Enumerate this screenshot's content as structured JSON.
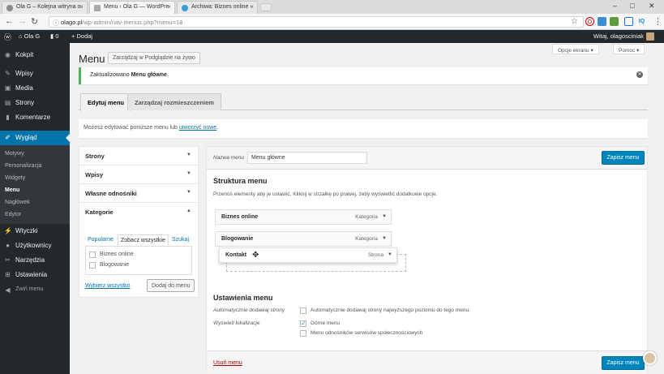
{
  "browser": {
    "tabs": [
      {
        "title": "Ola G – Kolejna witryna o"
      },
      {
        "title": "Menu ‹ Ola G — WordPre"
      },
      {
        "title": "Archiwa: Biznes online -"
      }
    ],
    "url_host": "olago.pl",
    "url_path": "/wp-admin/nav-menus.php?menu=18"
  },
  "adminbar": {
    "site": "Ola G",
    "comments": "0",
    "add_new": "Dodaj",
    "greeting": "Witaj, olagosciniak"
  },
  "sidebar": {
    "items": [
      {
        "label": "Kokpit",
        "icon": "dashboard-icon"
      },
      {
        "label": "Wpisy",
        "icon": "pin-icon"
      },
      {
        "label": "Media",
        "icon": "media-icon"
      },
      {
        "label": "Strony",
        "icon": "page-icon"
      },
      {
        "label": "Komentarze",
        "icon": "comment-icon"
      },
      {
        "label": "Wygląd",
        "icon": "brush-icon"
      },
      {
        "label": "Wtyczki",
        "icon": "plugin-icon"
      },
      {
        "label": "Użytkownicy",
        "icon": "users-icon"
      },
      {
        "label": "Narzędzia",
        "icon": "wrench-icon"
      },
      {
        "label": "Ustawienia",
        "icon": "settings-icon"
      },
      {
        "label": "Zwiń menu",
        "icon": "collapse-icon"
      }
    ],
    "submenu": [
      "Motywy",
      "Personalizacja",
      "Widgety",
      "Menu",
      "Nagłówek",
      "Edytor"
    ]
  },
  "screen_options": "Opcje ekranu",
  "help": "Pomoc",
  "page": {
    "title": "Menu",
    "live_preview": "Zarządzaj w Podglądzie na żywo",
    "notice_prefix": "Zaktualizowano",
    "notice_menu": "Menu główne",
    "notice_suffix": ".",
    "tabs": [
      "Edytuj menu",
      "Zarządzaj rozmieszczeniem"
    ],
    "info_text": "Możesz edytować poniższe menu lub",
    "info_link": "utworzyć nowe",
    "info_end": "."
  },
  "left": {
    "sections": [
      "Strony",
      "Wpisy",
      "Własne odnośniki",
      "Kategorie"
    ],
    "cat_tabs": [
      "Popularne",
      "Zobacz wszystkie",
      "Szukaj"
    ],
    "categories": [
      "Biznes online",
      "Blogowanie"
    ],
    "select_all": "Wybierz wszystko",
    "add_to_menu": "Dodaj do menu"
  },
  "right": {
    "menu_name_label": "Nazwa menu",
    "menu_name_value": "Menu główne",
    "save": "Zapisz menu",
    "structure_title": "Struktura menu",
    "structure_desc": "Przenoś elementy aby je ustawić. Kliknij w strzałkę po prawej, żeby wyświetlić dodatkowe opcje.",
    "items": [
      {
        "title": "Biznes online",
        "type": "Kategoria"
      },
      {
        "title": "Blogowanie",
        "type": "Kategoria"
      },
      {
        "title": "Kontakt",
        "type": "Strona"
      }
    ],
    "settings_title": "Ustawienia menu",
    "auto_add_label": "Automatycznie dodawaj strony",
    "auto_add_text": "Automatycznie dodawaj strony najwyższego poziomu do tego menu.",
    "location_label": "Wyświetl lokalizacje",
    "locations": [
      {
        "label": "Górne menu",
        "checked": true
      },
      {
        "label": "Menu odnośników serwisów społecznościowych",
        "checked": false
      }
    ],
    "delete": "Usuń menu"
  }
}
